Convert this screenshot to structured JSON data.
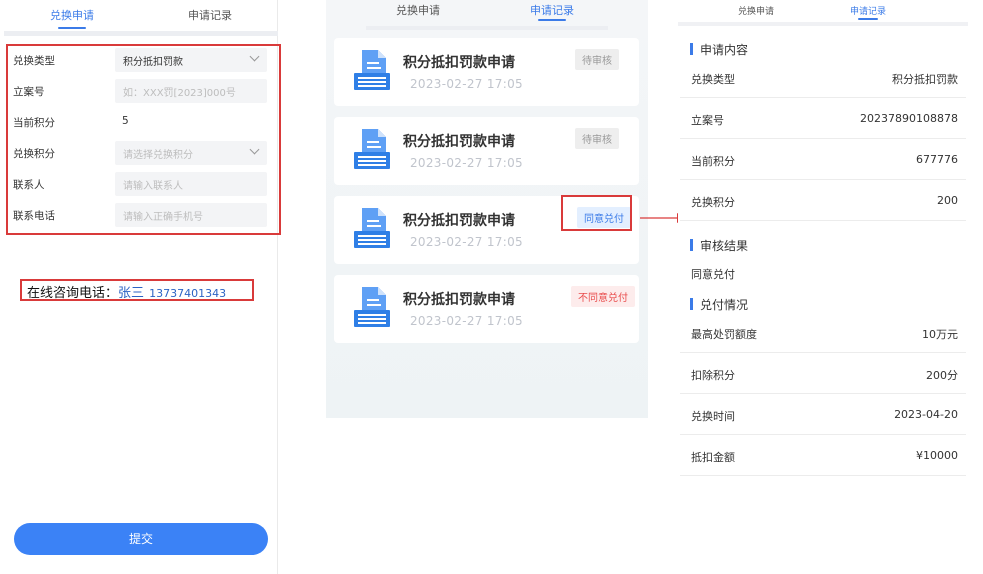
{
  "panel1": {
    "tabs": [
      "兑换申请",
      "申请记录"
    ],
    "form": {
      "type_label": "兑换类型",
      "type_value": "积分抵扣罚款",
      "case_label": "立案号",
      "case_placeholder": "如：XXX罚[2023]000号",
      "current_label": "当前积分",
      "current_value": "5",
      "exchange_label": "兑换积分",
      "exchange_placeholder": "请选择兑换积分",
      "contact_label": "联系人",
      "contact_placeholder": "请输入联系人",
      "phone_label": "联系电话",
      "phone_placeholder": "请输入正确手机号"
    },
    "consult": {
      "label": "在线咨询电话：",
      "name": "张三",
      "phone": "13737401343"
    },
    "submit_label": "提交"
  },
  "panel2": {
    "tabs": [
      "兑换申请",
      "申请记录"
    ],
    "cards": [
      {
        "title": "积分抵扣罚款申请",
        "date": "2023-02-27  17:05",
        "status": "待审核"
      },
      {
        "title": "积分抵扣罚款申请",
        "date": "2023-02-27  17:05",
        "status": "待审核"
      },
      {
        "title": "积分抵扣罚款申请",
        "date": "2023-02-27  17:05",
        "status": "同意兑付"
      },
      {
        "title": "积分抵扣罚款申请",
        "date": "2023-02-27  17:05",
        "status": "不同意兑付"
      }
    ]
  },
  "panel3": {
    "tabs": [
      "兑换申请",
      "申请记录"
    ],
    "section_apply": "申请内容",
    "apply_rows": [
      {
        "label": "兑换类型",
        "value": "积分抵扣罚款"
      },
      {
        "label": "立案号",
        "value": "20237890108878"
      },
      {
        "label": "当前积分",
        "value": "677776"
      },
      {
        "label": "兑换积分",
        "value": "200"
      }
    ],
    "section_result": "审核结果",
    "result_text": "同意兑付",
    "section_payout": "兑付情况",
    "payout_rows": [
      {
        "label": "最高处罚额度",
        "value": "10万元"
      },
      {
        "label": "扣除积分",
        "value": "200分"
      },
      {
        "label": "兑换时间",
        "value": "2023-04-20"
      },
      {
        "label": "抵扣金额",
        "value": "¥10000"
      }
    ]
  },
  "colors": {
    "accent": "#3b7be8",
    "highlight_border": "#d93a3a",
    "reject": "#e94b4b"
  }
}
